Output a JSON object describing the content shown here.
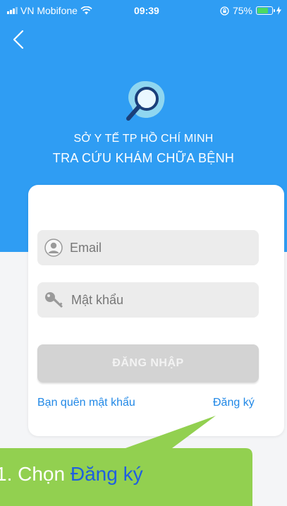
{
  "status_bar": {
    "carrier": "VN Mobifone",
    "time": "09:39",
    "battery_percent": "75%",
    "battery_level": 0.75
  },
  "header": {
    "title_line1": "SỞ Y TẾ TP HỒ CHÍ MINH",
    "title_line2": "TRA CỨU KHÁM CHỮA BỆNH",
    "background_color": "#2f9df3"
  },
  "login": {
    "email_placeholder": "Email",
    "password_placeholder": "Mật khẩu",
    "login_button_label": "ĐĂNG NHẬP",
    "forgot_password_label": "Bạn quên mật khẩu",
    "register_label": "Đăng ký"
  },
  "callout": {
    "prefix": "1. Chọn ",
    "highlight": "Đăng ký",
    "background_color": "#92d050",
    "highlight_color": "#1f5fe0"
  },
  "icons": [
    "back-chevron-icon",
    "magnifier-logo-icon",
    "user-icon",
    "key-icon",
    "wifi-icon",
    "lock-rotation-icon",
    "battery-icon",
    "charging-icon"
  ]
}
